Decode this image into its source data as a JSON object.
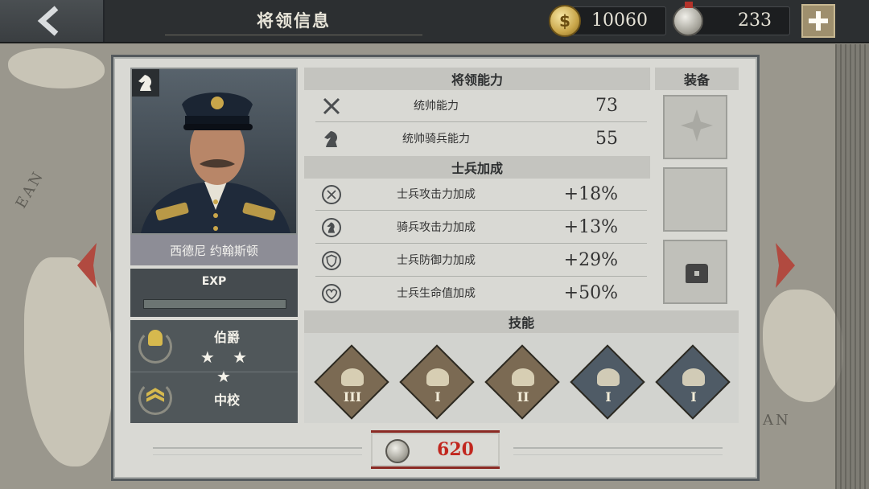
{
  "header": {
    "title": "将领信息",
    "gold_value": "10060",
    "medal_value": "233"
  },
  "general": {
    "name": "西德尼 约翰斯顿",
    "exp_label": "EXP",
    "exp_progress": 0.0,
    "rank_title": "伯爵",
    "stars": "★ ★ ★",
    "military_rank": "中校"
  },
  "abilities": {
    "heading": "将领能力",
    "rows": [
      {
        "label": "统帅能力",
        "value": "73",
        "icon": "swords-icon"
      },
      {
        "label": "统帅骑兵能力",
        "value": "55",
        "icon": "horse-head-icon"
      }
    ]
  },
  "bonuses": {
    "heading": "士兵加成",
    "rows": [
      {
        "label": "士兵攻击力加成",
        "value": "+18%",
        "icon": "attack-plus-icon"
      },
      {
        "label": "骑兵攻击力加成",
        "value": "+13%",
        "icon": "cavalry-plus-icon"
      },
      {
        "label": "士兵防御力加成",
        "value": "+29%",
        "icon": "shield-plus-icon"
      },
      {
        "label": "士兵生命值加成",
        "value": "+50%",
        "icon": "heart-plus-icon"
      }
    ]
  },
  "skills": {
    "heading": "技能",
    "items": [
      {
        "level": "III",
        "color": "#7b6a53",
        "icon": "cavalry-charge-icon"
      },
      {
        "level": "I",
        "color": "#7b6a53",
        "icon": "horse-head-icon"
      },
      {
        "level": "II",
        "color": "#7b6a53",
        "icon": "helmet-icon"
      },
      {
        "level": "I",
        "color": "#4f5b66",
        "icon": "fist-icon"
      },
      {
        "level": "I",
        "color": "#4f5b66",
        "icon": "horn-icon"
      }
    ]
  },
  "equipment": {
    "heading": "装备"
  },
  "cost": {
    "value": "620"
  },
  "colors": {
    "accent_red": "#c1271f",
    "gold": "#c9a64a"
  }
}
